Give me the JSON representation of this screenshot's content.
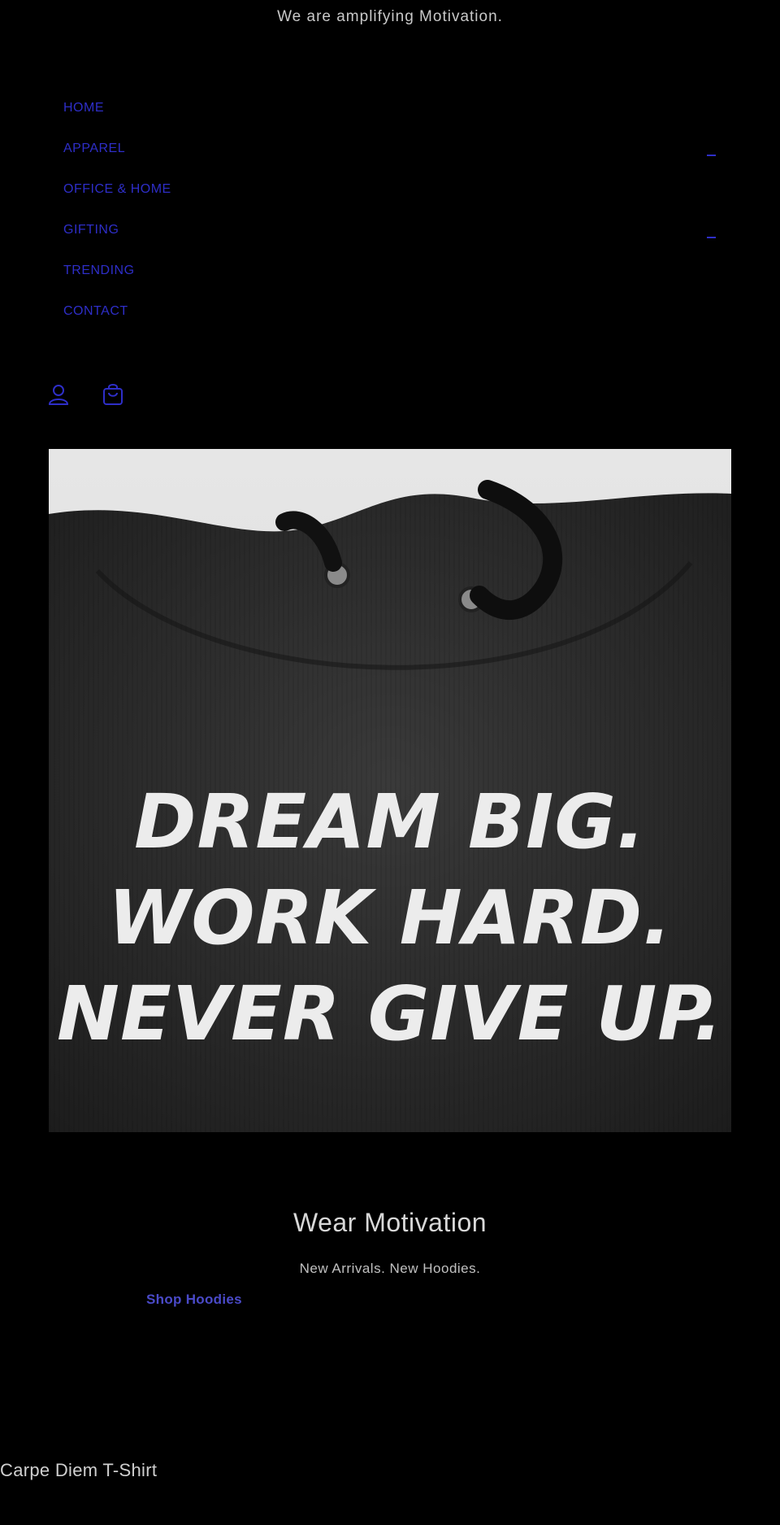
{
  "announcement": "We are amplifying Motivation.",
  "nav": {
    "items": [
      {
        "label": "HOME"
      },
      {
        "label": "APPAREL"
      },
      {
        "label": "OFFICE & HOME"
      },
      {
        "label": "GIFTING"
      },
      {
        "label": "TRENDING"
      },
      {
        "label": "CONTACT"
      }
    ]
  },
  "icons": {
    "account": "account-icon",
    "cart": "cart-icon",
    "submenu": "chevron-icon"
  },
  "hero": {
    "quote_lines": [
      "DREAM BIG.",
      "WORK HARD.",
      "NEVER GIVE UP."
    ],
    "title": "Wear Motivation",
    "subtitle": "New Arrivals. New Hoodies.",
    "cta": "Shop Hoodies"
  },
  "product": {
    "title": "Carpe Diem T-Shirt"
  },
  "colors": {
    "background": "#000000",
    "link": "#2e2ec8",
    "text": "#cfcfcf"
  }
}
